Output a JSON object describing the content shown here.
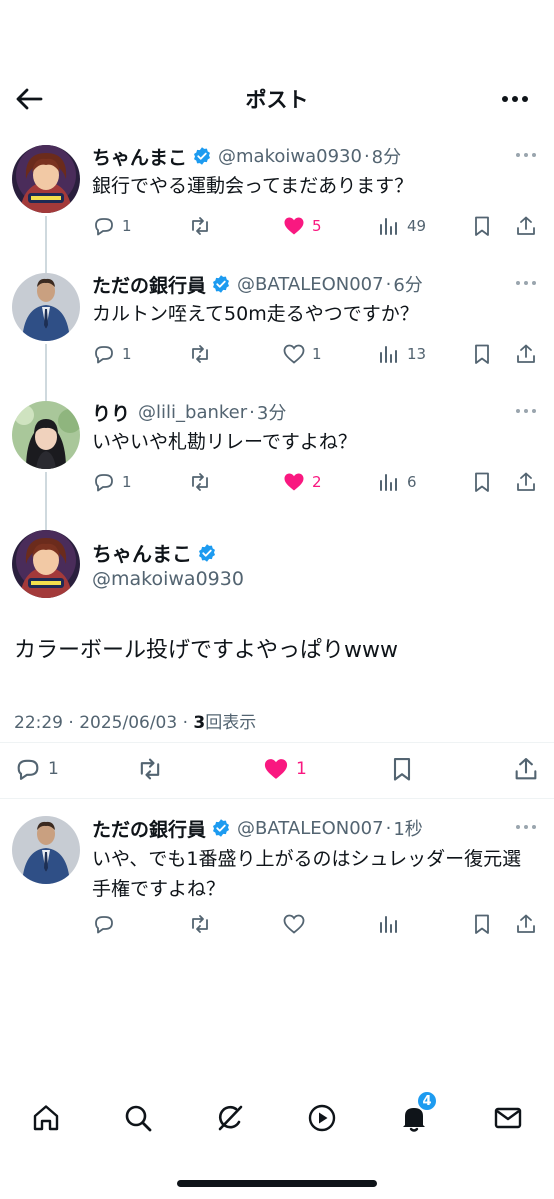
{
  "header": {
    "title": "ポスト"
  },
  "replies": [
    {
      "name": "ちゃんまこ",
      "handle": "@makoiwa0930",
      "time": "8分",
      "text": "銀行でやる運動会ってまだあります？",
      "replies": "1",
      "reposts": "",
      "likes": "5",
      "liked": true,
      "views": "49",
      "avatar": "anime-girl-avatar"
    },
    {
      "name": "ただの銀行員",
      "handle": "@BATALEON007",
      "time": "6分",
      "text": "カルトン咥えて50m走るやつですか？",
      "replies": "1",
      "reposts": "",
      "likes": "1",
      "liked": false,
      "views": "13",
      "avatar": "suit-man-avatar"
    },
    {
      "name": "りり",
      "handle": "@lili_banker",
      "time": "3分",
      "text": "いやいや札勘リレーですよね？",
      "replies": "1",
      "reposts": "",
      "likes": "2",
      "liked": true,
      "views": "6",
      "avatar": "woman-photo-avatar"
    }
  ],
  "main": {
    "name": "ちゃんまこ",
    "handle": "@makoiwa0930",
    "text": "カラーボール投げですよやっぱりwww",
    "timestamp": "22:29 · 2025/06/03 · ",
    "views_count": "3",
    "views_label": "回表示",
    "replies": "1",
    "likes": "1"
  },
  "latest_reply": {
    "name": "ただの銀行員",
    "handle": "@BATALEON007",
    "time": "1秒",
    "text": "いや、でも1番盛り上がるのはシュレッダー復元選手権ですよね？"
  },
  "nav": {
    "notifications_badge": "4"
  },
  "colors": {
    "like": "#f91880",
    "verified": "#1d9bf0",
    "muted": "#536471",
    "text": "#0f1419"
  }
}
